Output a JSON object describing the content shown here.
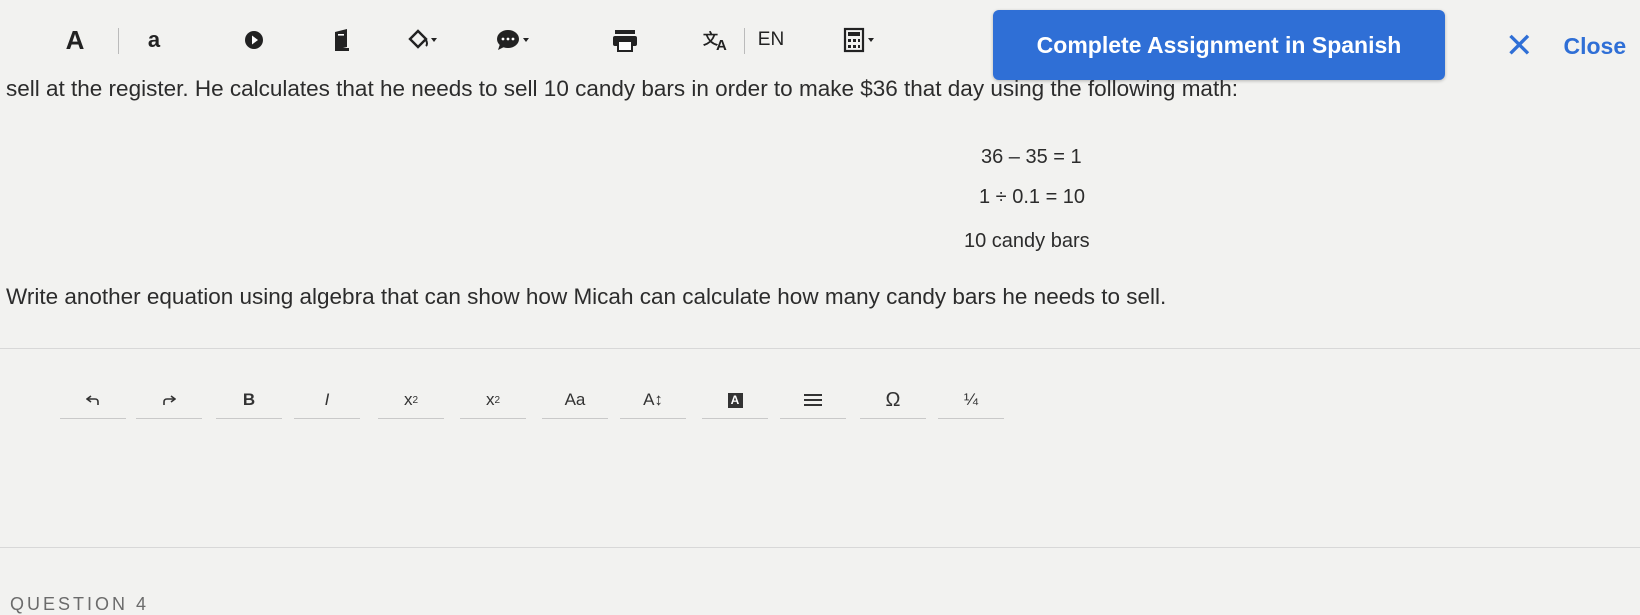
{
  "toolbar": {
    "text_large_label": "A",
    "text_small_label": "a",
    "language_label": "EN",
    "spanish_button_label": "Complete Assignment in Spanish",
    "close_label": "Close",
    "accent_color": "#2f6fd6"
  },
  "question": {
    "intro_line": "sell at the register. He calculates that he needs to sell 10 candy bars in order to make $36 that day using the following math:",
    "math_lines": [
      "36 – 35 = 1",
      "1 ÷ 0.1 = 10",
      "10 candy bars"
    ],
    "prompt": "Write another equation using algebra that can show how Micah can calculate how many candy bars he needs to sell."
  },
  "editor_toolbar": {
    "bold_label": "B",
    "italic_label": "I",
    "superscript_base": "x",
    "superscript_exp": "2",
    "subscript_base": "x",
    "subscript_idx": "2",
    "case_label": "Aa",
    "size_label": "A↕",
    "highlight_label": "A",
    "omega_label": "Ω",
    "fraction_label": "¼"
  },
  "next_section_label": "QUESTION 4",
  "icons": [
    "play-icon",
    "book-icon",
    "paint-bucket-icon",
    "speech-bubble-icon",
    "printer-icon",
    "translate-icon",
    "calculator-icon",
    "close-icon",
    "undo-icon",
    "redo-icon",
    "list-icon"
  ]
}
